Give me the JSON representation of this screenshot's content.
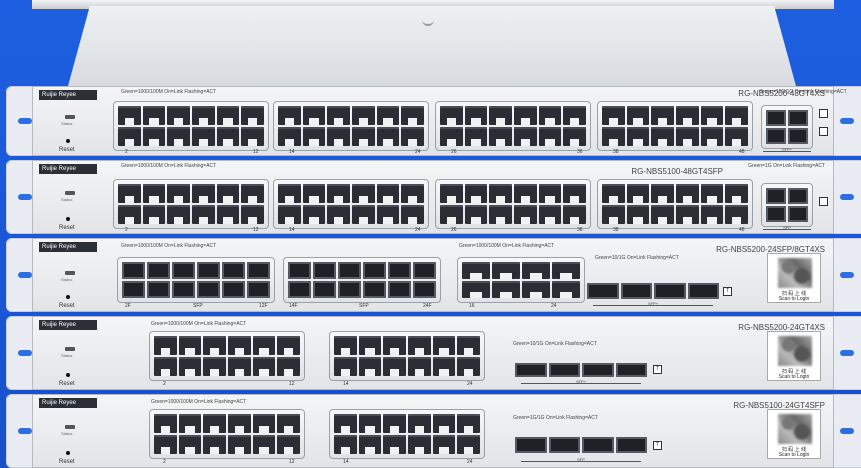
{
  "units": [
    {
      "brand": "Ruijie  Reyee",
      "model": "RG-NBS5200-48GT4XS",
      "legend": "Green=1000/100M  On=Link  Flashing=ACT",
      "sfp_legend": "Green=10G/1G  On=Link  Flashing=ACT",
      "status": "Status",
      "reset": "Reset",
      "port_nums": [
        "2",
        "12",
        "14",
        "24",
        "26",
        "36",
        "38",
        "48"
      ],
      "sfp_label": "SFP+",
      "sfp_nums": [
        "49",
        "50",
        "51",
        "52"
      ]
    },
    {
      "brand": "Ruijie  Reyee",
      "model": "RG-NBS5100-48GT4SFP",
      "legend": "Green=1000/100M  On=Link  Flashing=ACT",
      "sfp_legend": "Green=1G  On=Link  Flashing=ACT",
      "status": "Status",
      "reset": "Reset",
      "port_nums": [
        "2",
        "12",
        "14",
        "24",
        "26",
        "36",
        "38",
        "48"
      ],
      "sfp_label": "SFP",
      "sfp_nums": [
        "49",
        "50",
        "51",
        "52"
      ]
    },
    {
      "brand": "Ruijie  Reyee",
      "model": "RG-NBS5200-24SFP/8GT4XS",
      "legend": "Green=1000/100M  On=Link  Flashing=ACT",
      "legend2": "Green=1000/100M  On=Link  Flashing=ACT",
      "sfp_legend": "Green=10/1G  On=Link  Flashing=ACT",
      "status": "Status",
      "reset": "Reset",
      "port_nums": [
        "2F",
        "SFP",
        "12F",
        "14F",
        "SFP",
        "24F",
        "16",
        "24"
      ],
      "sfp_label": "SFP+",
      "sq_label": "T",
      "qr_line1": "扫 码 上 线",
      "qr_line2": "Scan to Login"
    },
    {
      "brand": "Ruijie  Reyee",
      "model": "RG-NBS5200-24GT4XS",
      "legend": "Green=1000/100M  On=Link  Flashing=ACT",
      "sfp_legend": "Green=10/1G  On=Link  Flashing=ACT",
      "status": "Status",
      "reset": "Reset",
      "port_nums": [
        "2",
        "12",
        "14",
        "24"
      ],
      "sfp_label": "SFP+",
      "sq_label": "T",
      "qr_line1": "扫 码 上 线",
      "qr_line2": "Scan to Login"
    },
    {
      "brand": "Ruijie  Reyee",
      "model": "RG-NBS5100-24GT4SFP",
      "legend": "Green=1000/100M  On=Link  Flashing=ACT",
      "sfp_legend": "Green=1G/1G  On=Link  Flashing=ACT",
      "status": "Status",
      "reset": "Reset",
      "port_nums": [
        "2",
        "12",
        "14",
        "24"
      ],
      "sfp_label": "SFP",
      "sq_label": "T",
      "qr_line1": "扫 码 上 线",
      "qr_line2": "Scan to Login"
    }
  ],
  "colors": {
    "background": "#1a56d6",
    "accent": "#3fd7c8",
    "port": "#2a2d33"
  }
}
